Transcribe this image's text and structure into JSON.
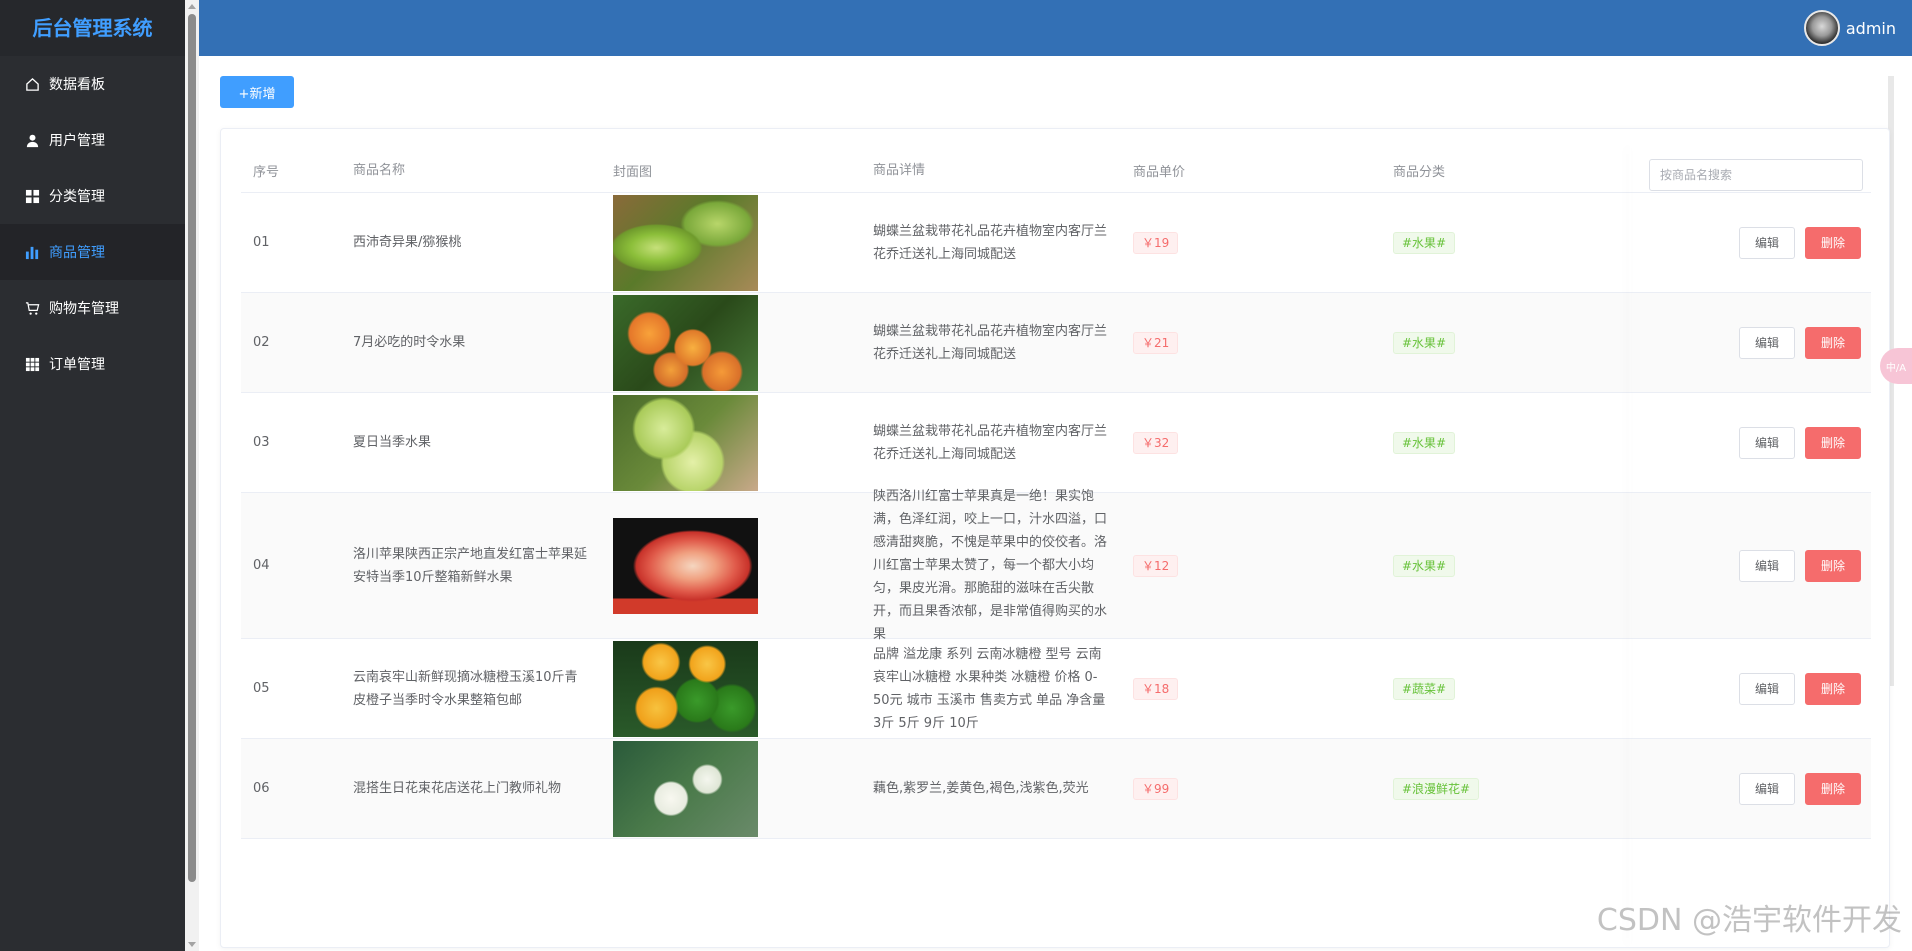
{
  "app": {
    "title": "后台管理系统"
  },
  "sidebar": {
    "items": [
      {
        "label": "数据看板",
        "icon": "home-icon",
        "active": false
      },
      {
        "label": "用户管理",
        "icon": "user-icon",
        "active": false
      },
      {
        "label": "分类管理",
        "icon": "grid-icon",
        "active": false
      },
      {
        "label": "商品管理",
        "icon": "bar-chart-icon",
        "active": true
      },
      {
        "label": "购物车管理",
        "icon": "cart-icon",
        "active": false
      },
      {
        "label": "订单管理",
        "icon": "apps-icon",
        "active": false
      }
    ]
  },
  "header": {
    "username": "admin"
  },
  "toolbar": {
    "add_label": "+新增"
  },
  "table": {
    "columns": [
      "序号",
      "商品名称",
      "封面图",
      "商品详情",
      "商品单价",
      "商品分类"
    ],
    "search_placeholder": "按商品名搜索",
    "edit_label": "编辑",
    "delete_label": "删除",
    "rows": [
      {
        "idx": "01",
        "name": "西沛奇异果/猕猴桃",
        "cover": "kiwi",
        "detail": "蝴蝶兰盆栽带花礼品花卉植物室内客厅兰花乔迁送礼上海同城配送",
        "price": "￥19",
        "category": "#水果#"
      },
      {
        "idx": "02",
        "name": "7月必吃的时令水果",
        "cover": "apricot",
        "detail": "蝴蝶兰盆栽带花礼品花卉植物室内客厅兰花乔迁送礼上海同城配送",
        "price": "￥21",
        "category": "#水果#"
      },
      {
        "idx": "03",
        "name": "夏日当季水果",
        "cover": "apple",
        "detail": "蝴蝶兰盆栽带花礼品花卉植物室内客厅兰花乔迁送礼上海同城配送",
        "price": "￥32",
        "category": "#水果#"
      },
      {
        "idx": "04",
        "name": "洛川苹果陕西正宗产地直发红富士苹果延安特当季10斤整箱新鲜水果",
        "cover": "redapple",
        "detail": "陕西洛川红富士苹果真是一绝！果实饱满，色泽红润，咬上一口，汁水四溢，口感清甜爽脆，不愧是苹果中的佼佼者。洛川红富士苹果太赞了，每一个都大小均匀，果皮光滑。那脆甜的滋味在舌尖散开，而且果香浓郁，是非常值得购买的水果",
        "price": "￥12",
        "category": "#水果#"
      },
      {
        "idx": "05",
        "name": "云南哀牢山新鲜现摘冰糖橙玉溪10斤青皮橙子当季时令水果整箱包邮",
        "cover": "orange",
        "detail": "品牌 溢龙康 系列 云南冰糖橙 型号 云南哀牢山冰糖橙 水果种类 冰糖橙 价格 0-50元 城市 玉溪市 售卖方式 单品 净含量 3斤 5斤 9斤 10斤",
        "price": "￥18",
        "category": "#蔬菜#"
      },
      {
        "idx": "06",
        "name": "混搭生日花束花店送花上门教师礼物",
        "cover": "flower",
        "detail": "藕色,紫罗兰,姜黄色,褐色,浅紫色,荧光",
        "price": "￥99",
        "category": "#浪漫鲜花#"
      }
    ]
  },
  "overlay": {
    "float_label": "中/A",
    "watermark": "CSDN @浩宇软件开发"
  }
}
